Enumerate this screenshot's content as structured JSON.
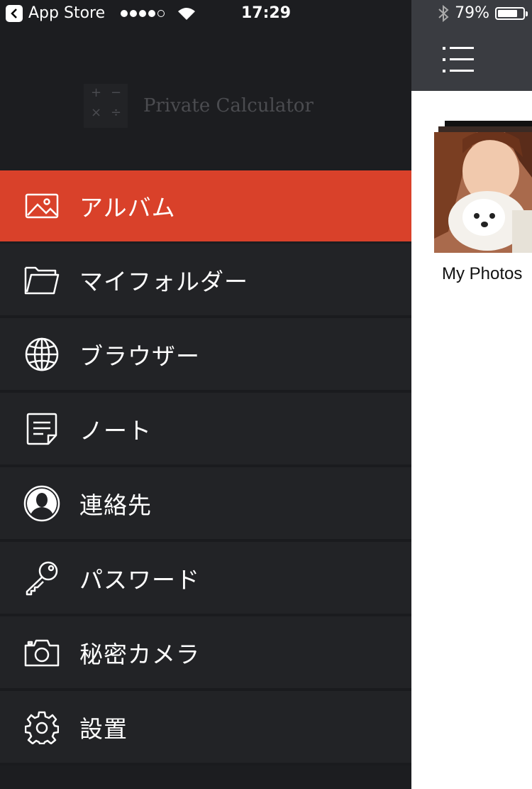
{
  "status_bar": {
    "back_app": "App Store",
    "time": "17:29",
    "battery": "79%",
    "battery_level": 0.79,
    "signal_bars": 4
  },
  "drawer": {
    "logo_text": "Private Calculator",
    "logo_symbols": [
      "+",
      "−",
      "×",
      "÷"
    ],
    "items": [
      {
        "label": "アルバム",
        "icon": "image-icon",
        "active": true
      },
      {
        "label": "マイフォルダー",
        "icon": "folder-icon",
        "active": false
      },
      {
        "label": "ブラウザー",
        "icon": "globe-icon",
        "active": false
      },
      {
        "label": "ノート",
        "icon": "note-icon",
        "active": false
      },
      {
        "label": "連絡先",
        "icon": "contact-icon",
        "active": false
      },
      {
        "label": "パスワード",
        "icon": "key-icon",
        "active": false
      },
      {
        "label": "秘密カメラ",
        "icon": "camera-icon",
        "active": false
      },
      {
        "label": "設置",
        "icon": "gear-icon",
        "active": false
      }
    ]
  },
  "content": {
    "menu_icon": "hamburger-menu-icon",
    "album": {
      "title": "My Photos",
      "thumbnail": "photo-thumbnail"
    }
  },
  "colors": {
    "accent": "#d9412a",
    "drawer_bg": "#1c1d20",
    "item_bg": "#222326",
    "navbar_bg": "#3a3c41"
  }
}
